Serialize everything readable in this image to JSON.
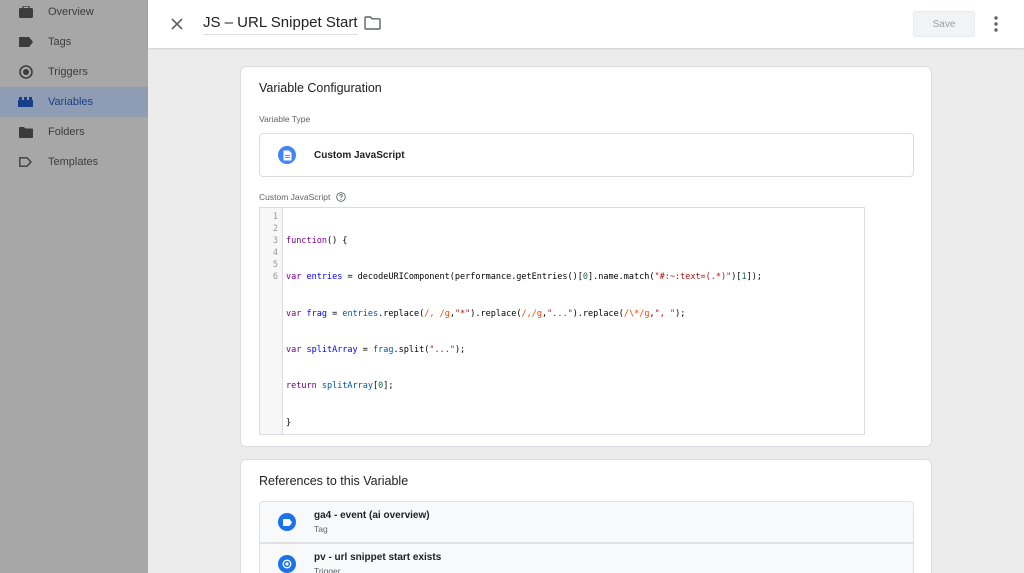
{
  "sidebar": {
    "items": [
      {
        "label": "Overview",
        "icon": "briefcase-icon"
      },
      {
        "label": "Tags",
        "icon": "tag-icon"
      },
      {
        "label": "Triggers",
        "icon": "trigger-icon"
      },
      {
        "label": "Variables",
        "icon": "variables-icon",
        "active": true
      },
      {
        "label": "Folders",
        "icon": "folder-icon"
      },
      {
        "label": "Templates",
        "icon": "template-icon"
      }
    ]
  },
  "header": {
    "title": "JS – URL Snippet Start",
    "save_label": "Save"
  },
  "config": {
    "title": "Variable Configuration",
    "type_label": "Variable Type",
    "type_name": "Custom JavaScript",
    "code_label": "Custom JavaScript",
    "line_numbers": [
      "1",
      "2",
      "3",
      "4",
      "5",
      "6"
    ],
    "code_lines": [
      "function() {",
      "var entries = decodeURIComponent(performance.getEntries()[0].name.match(\"#:~:text=(.*)\")[1]);",
      "var frag = entries.replace(/, /g,\"*\").replace(/,/g,\"...\").replace(/\\*/g,\", \");",
      "var splitArray = frag.split(\"...\");",
      "return splitArray[0];",
      "}"
    ]
  },
  "references": {
    "title": "References to this Variable",
    "items": [
      {
        "name": "ga4 - event (ai overview)",
        "type": "Tag"
      },
      {
        "name": "pv - url snippet start exists",
        "type": "Trigger"
      }
    ]
  },
  "colors": {
    "active_nav": "#1a3f8a",
    "accent_blue": "#4285f4",
    "tag_blue": "#1a73e8"
  }
}
